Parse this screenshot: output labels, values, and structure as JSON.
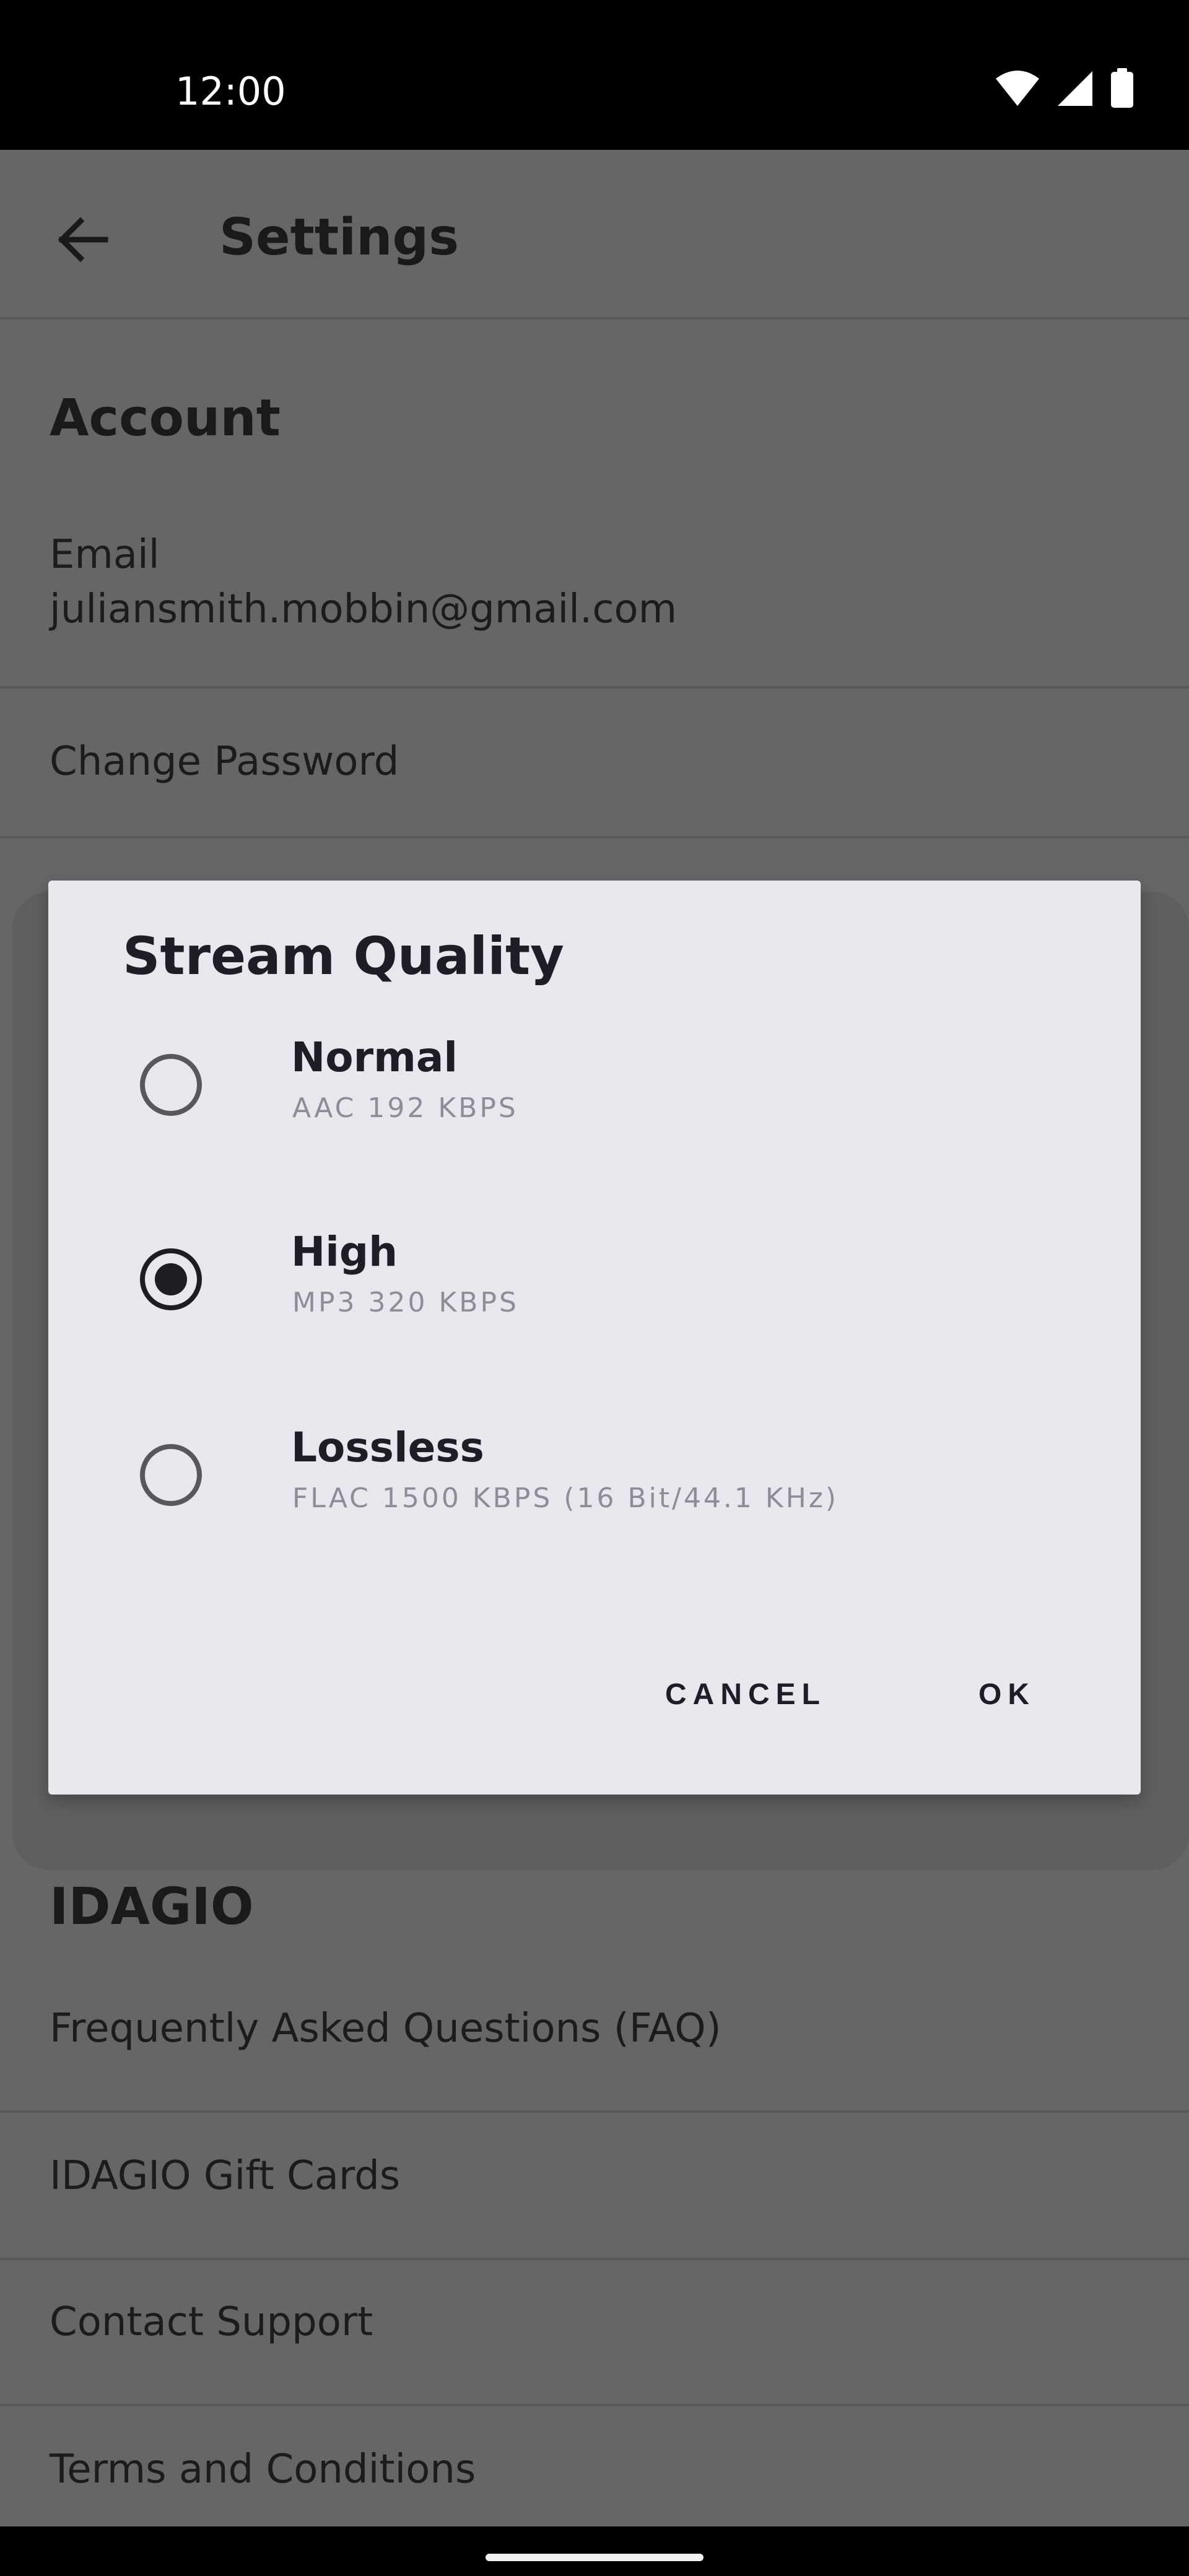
{
  "status_bar": {
    "time": "12:00",
    "icons": [
      "wifi-icon",
      "cellular-signal-icon",
      "battery-icon"
    ]
  },
  "app_bar": {
    "title": "Settings",
    "back_icon": "arrow-back-icon"
  },
  "sections": {
    "account_heading": "Account",
    "email_label": "Email",
    "email_value": "juliansmith.mobbin@gmail.com",
    "change_password": "Change Password",
    "idagio_heading": "IDAGIO",
    "faq": "Frequently Asked Questions (FAQ)",
    "gift_cards": "IDAGIO Gift Cards",
    "contact_support": "Contact Support",
    "terms": "Terms and Conditions"
  },
  "dialog": {
    "title": "Stream Quality",
    "options": [
      {
        "label": "Normal",
        "sub": "AAC 192 KBPS",
        "selected": false
      },
      {
        "label": "High",
        "sub": "MP3 320 KBPS",
        "selected": true
      },
      {
        "label": "Lossless",
        "sub": "FLAC 1500 KBPS (16 Bit/44.1 KHz)",
        "selected": false
      }
    ],
    "cancel_label": "CANCEL",
    "ok_label": "OK"
  },
  "colors": {
    "scrim_background": "#666666",
    "dialog_background": "#e8e7ec",
    "primary_text": "#1e1e24",
    "secondary_text": "#8e8d94"
  }
}
